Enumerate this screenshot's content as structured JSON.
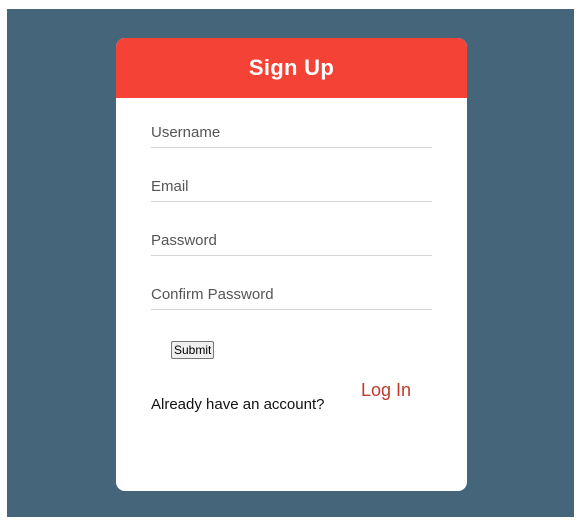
{
  "form": {
    "title": "Sign Up",
    "fields": [
      {
        "name": "username",
        "placeholder": "Username",
        "value": ""
      },
      {
        "name": "email",
        "placeholder": "Email",
        "value": ""
      },
      {
        "name": "password",
        "placeholder": "Password",
        "value": ""
      },
      {
        "name": "confirm_password",
        "placeholder": "Confirm Password",
        "value": ""
      }
    ],
    "submit_label": "Submit",
    "footer_text": "Already have an account?",
    "login_label": "Log In"
  },
  "colors": {
    "background": "#44657a",
    "header": "#f44336",
    "link": "#c0392b"
  }
}
